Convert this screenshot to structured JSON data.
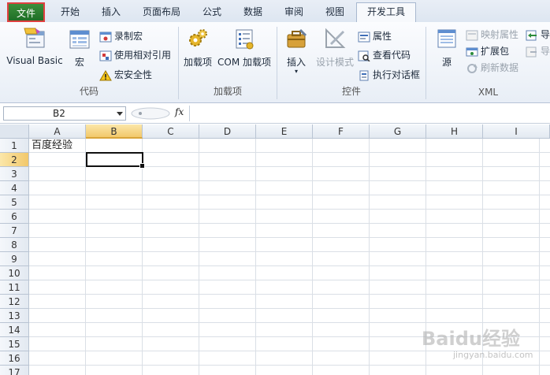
{
  "tabs": [
    "文件",
    "开始",
    "插入",
    "页面布局",
    "公式",
    "数据",
    "审阅",
    "视图",
    "开发工具"
  ],
  "ribbon": {
    "code": {
      "label": "代码",
      "visual_basic": "Visual Basic",
      "macros": "宏",
      "record_macro": "录制宏",
      "relative_ref": "使用相对引用",
      "macro_security": "宏安全性"
    },
    "addins": {
      "label": "加载项",
      "addins": "加载项",
      "com_addins": "COM 加载项"
    },
    "controls": {
      "label": "控件",
      "insert": "插入",
      "design_mode": "设计模式",
      "properties": "属性",
      "view_code": "查看代码",
      "run_dialog": "执行对话框"
    },
    "xml": {
      "label": "XML",
      "source": "源",
      "map_properties": "映射属性",
      "expansion_packs": "扩展包",
      "refresh_data": "刷新数据",
      "import": "导入",
      "export": "导出"
    }
  },
  "formula_bar": {
    "name_box": "B2",
    "fx": "fx",
    "formula": ""
  },
  "sheet": {
    "columns": [
      "A",
      "B",
      "C",
      "D",
      "E",
      "F",
      "G",
      "H",
      "I"
    ],
    "rows": [
      "1",
      "2",
      "3",
      "4",
      "5",
      "6",
      "7",
      "8",
      "9",
      "10",
      "11",
      "12",
      "13",
      "14",
      "15",
      "16",
      "17"
    ],
    "selected_cell": "B2",
    "cell_A1": "百度经验"
  },
  "watermark": {
    "text": "Baidu经验",
    "sub": "jingyan.baidu.com"
  },
  "colors": {
    "file_tab": "#2a7a30",
    "selection_header": "#f2c86b",
    "accent_border": "#e04040"
  }
}
